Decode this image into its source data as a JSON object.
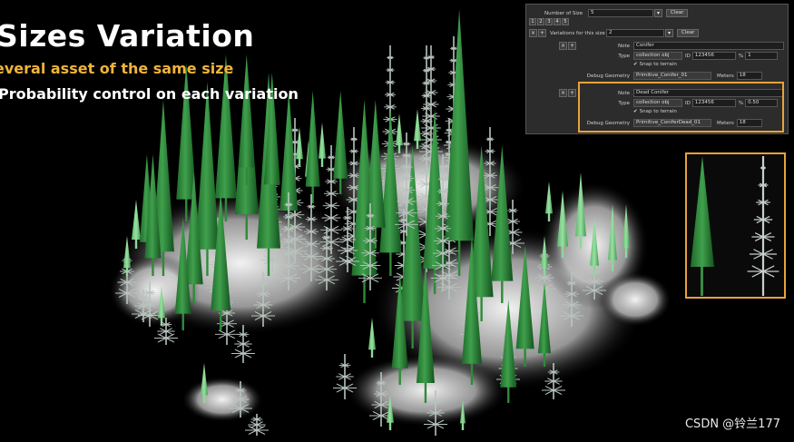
{
  "slide": {
    "title": "Sizes Variation",
    "bullet1": "everal asset of the same size",
    "bullet2": "Probability control on each variation",
    "watermark": "CSDN @铃兰177"
  },
  "panel": {
    "number_of_size_label": "Number of Size",
    "number_of_size_value": "5",
    "clear_label": "Clear",
    "size_tabs": [
      "1",
      "2",
      "3",
      "4",
      "5"
    ],
    "variations_label": "Variations for this size",
    "variations_value": "2",
    "add_label": "+",
    "remove_label": "×",
    "variation1": {
      "note_label": "Note",
      "note_value": "Conifer",
      "type_label": "Type",
      "type_value": "collection obj",
      "id_label": "ID",
      "id_value": "123456",
      "prob_label": "%",
      "prob_value": "1",
      "snap_label": "Snap to terrain",
      "debug_label": "Debug Geometry",
      "debug_value": "Primitive_Conifer_01",
      "meters_label": "Meters",
      "meters_value": "18"
    },
    "variation2": {
      "note_label": "Note",
      "note_value": "Dead Conifer",
      "type_label": "Type",
      "type_value": "collection obj",
      "id_label": "ID",
      "id_value": "123456",
      "prob_label": "%",
      "prob_value": "0.50",
      "snap_label": "Snap to terrain",
      "debug_label": "Debug Geometry",
      "debug_value": "Primitive_ConiferDead_01",
      "meters_label": "Meters",
      "meters_value": "18"
    }
  },
  "colors": {
    "highlight": "#e9a23b",
    "subtitle": "#f0b43a",
    "tree_green": "#2e8a3a",
    "dead_tree": "#b8c4bd"
  }
}
